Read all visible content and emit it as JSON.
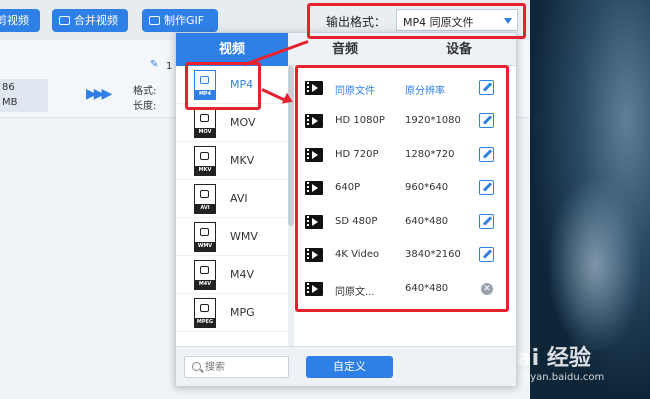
{
  "toolbar": {
    "btn1": "剪视频",
    "merge": "合并视频",
    "gif": "制作GIF"
  },
  "bg": {
    "num": "86",
    "size": "MB",
    "format_label": "格式:",
    "length_label": "长度:",
    "edit_num": "1"
  },
  "output": {
    "label": "输出格式：",
    "value": "MP4  同原文件"
  },
  "tabs": [
    "视频",
    "音频",
    "设备"
  ],
  "formats": [
    {
      "label": "MP4",
      "band": "MP4"
    },
    {
      "label": "MOV",
      "band": "MOV"
    },
    {
      "label": "MKV",
      "band": "MKV"
    },
    {
      "label": "AVI",
      "band": "AVI"
    },
    {
      "label": "WMV",
      "band": "WMV"
    },
    {
      "label": "M4V",
      "band": "M4V"
    },
    {
      "label": "MPG",
      "band": "MPEG"
    }
  ],
  "resolutions": [
    {
      "name": "同原文件",
      "value": "原分辨率",
      "action": "edit"
    },
    {
      "name": "HD 1080P",
      "value": "1920*1080",
      "action": "edit"
    },
    {
      "name": "HD 720P",
      "value": "1280*720",
      "action": "edit"
    },
    {
      "name": "640P",
      "value": "960*640",
      "action": "edit"
    },
    {
      "name": "SD 480P",
      "value": "640*480",
      "action": "edit"
    },
    {
      "name": "4K Video",
      "value": "3840*2160",
      "action": "edit"
    },
    {
      "name": "同原文...",
      "value": "640*480",
      "action": "delete"
    }
  ],
  "footer": {
    "search_placeholder": "搜索",
    "custom_label": "自定义"
  },
  "watermark": {
    "brand": "Bai 经验",
    "url": "jingyan.baidu.com"
  },
  "colors": {
    "accent": "#2f80e6",
    "annotation": "#e8212f"
  }
}
